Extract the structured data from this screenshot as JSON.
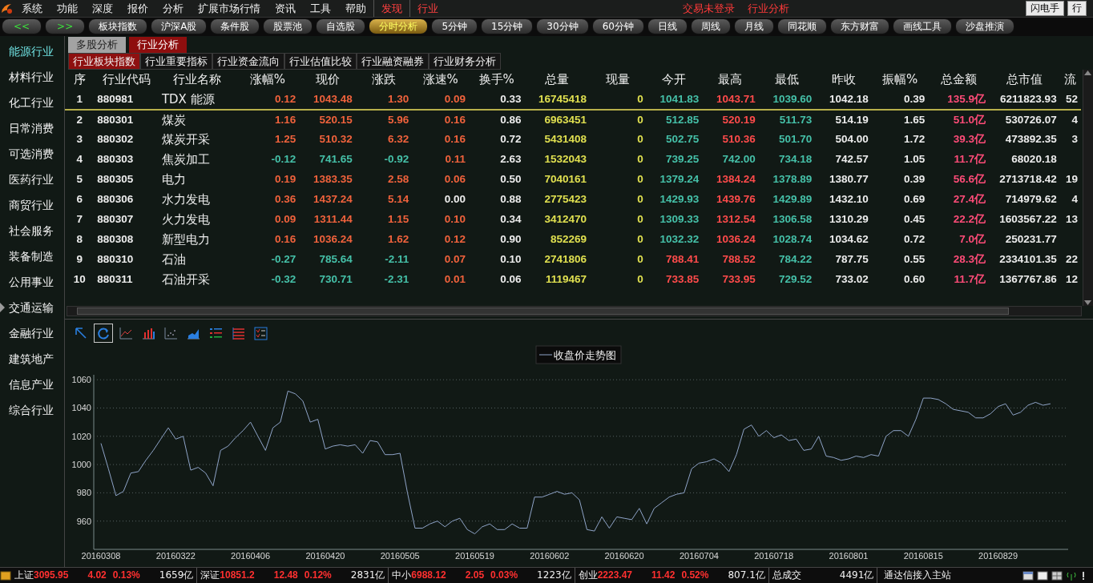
{
  "menu": {
    "items": [
      {
        "label": "系统",
        "kind": "plain"
      },
      {
        "label": "功能",
        "kind": "plain"
      },
      {
        "label": "深度",
        "kind": "plain"
      },
      {
        "label": "报价",
        "kind": "plain"
      },
      {
        "label": "分析",
        "kind": "plain"
      },
      {
        "label": "扩展市场行情",
        "kind": "plain"
      },
      {
        "label": "资讯",
        "kind": "plain"
      },
      {
        "label": "工具",
        "kind": "plain"
      },
      {
        "label": "帮助",
        "kind": "plain"
      },
      {
        "label": "发现",
        "kind": "accent"
      },
      {
        "label": "行业",
        "kind": "accent"
      }
    ],
    "status": [
      "交易未登录",
      "行业分析"
    ],
    "buttons": [
      "闪电手",
      "行"
    ]
  },
  "toolbar": {
    "arrows": [
      "<<",
      ">>"
    ],
    "tabs": [
      {
        "label": "板块指数",
        "selected": false
      },
      {
        "label": "沪深A股",
        "selected": false
      },
      {
        "label": "条件股",
        "selected": false
      },
      {
        "label": "股票池",
        "selected": false
      },
      {
        "label": "自选股",
        "selected": false
      },
      {
        "label": "分时分析",
        "selected": true
      },
      {
        "label": "5分钟",
        "selected": false
      },
      {
        "label": "15分钟",
        "selected": false
      },
      {
        "label": "30分钟",
        "selected": false
      },
      {
        "label": "60分钟",
        "selected": false
      },
      {
        "label": "日线",
        "selected": false
      },
      {
        "label": "周线",
        "selected": false
      },
      {
        "label": "月线",
        "selected": false
      },
      {
        "label": "同花顺",
        "selected": false
      },
      {
        "label": "东方财富",
        "selected": false
      },
      {
        "label": "画线工具",
        "selected": false
      },
      {
        "label": "沙盘推演",
        "selected": false
      }
    ]
  },
  "sidebar": {
    "items": [
      {
        "label": "能源行业",
        "selected": true,
        "pointer": false
      },
      {
        "label": "材料行业",
        "selected": false,
        "pointer": false
      },
      {
        "label": "化工行业",
        "selected": false,
        "pointer": false
      },
      {
        "label": "日常消费",
        "selected": false,
        "pointer": false
      },
      {
        "label": "可选消费",
        "selected": false,
        "pointer": false
      },
      {
        "label": "医药行业",
        "selected": false,
        "pointer": false
      },
      {
        "label": "商贸行业",
        "selected": false,
        "pointer": false
      },
      {
        "label": "社会服务",
        "selected": false,
        "pointer": false
      },
      {
        "label": "装备制造",
        "selected": false,
        "pointer": false
      },
      {
        "label": "公用事业",
        "selected": false,
        "pointer": false
      },
      {
        "label": "交通运输",
        "selected": false,
        "pointer": true
      },
      {
        "label": "金融行业",
        "selected": false,
        "pointer": false
      },
      {
        "label": "建筑地产",
        "selected": false,
        "pointer": false
      },
      {
        "label": "信息产业",
        "selected": false,
        "pointer": false
      },
      {
        "label": "综合行业",
        "selected": false,
        "pointer": false
      }
    ]
  },
  "tabs": [
    {
      "label": "多股分析",
      "selected": false
    },
    {
      "label": "行业分析",
      "selected": true
    }
  ],
  "subtabs": [
    {
      "label": "行业板块指数",
      "selected": true
    },
    {
      "label": "行业重要指标",
      "selected": false
    },
    {
      "label": "行业资金流向",
      "selected": false
    },
    {
      "label": "行业估值比较",
      "selected": false
    },
    {
      "label": "行业融资融券",
      "selected": false
    },
    {
      "label": "行业财务分析",
      "selected": false
    }
  ],
  "table": {
    "columns": [
      "序",
      "行业代码",
      "行业名称",
      "涨幅%",
      "现价",
      "涨跌",
      "涨速%",
      "换手%",
      "总量",
      "现量",
      "今开",
      "最高",
      "最低",
      "昨收",
      "振幅%",
      "总金额",
      "总市值",
      "流"
    ],
    "rows": [
      {
        "selected": true,
        "cells": [
          {
            "text": "1",
            "color": "#ececec"
          },
          {
            "text": "880981",
            "color": "#ececec"
          },
          {
            "text": "TDX 能源",
            "color": "#ececec"
          },
          {
            "text": "0.12",
            "color": "#f0623c"
          },
          {
            "text": "1043.48",
            "color": "#f0623c"
          },
          {
            "text": "1.30",
            "color": "#f0623c"
          },
          {
            "text": "0.09",
            "color": "#f0623c"
          },
          {
            "text": "0.33",
            "color": "#ececec"
          },
          {
            "text": "16745418",
            "color": "#e0e050"
          },
          {
            "text": "0",
            "color": "#e0e050"
          },
          {
            "text": "1041.83",
            "color": "#45c0a8"
          },
          {
            "text": "1043.71",
            "color": "#ff4b4b"
          },
          {
            "text": "1039.60",
            "color": "#45c0a8"
          },
          {
            "text": "1042.18",
            "color": "#ececec"
          },
          {
            "text": "0.39",
            "color": "#ececec"
          },
          {
            "text": "135.9亿",
            "color": "#ff4c78"
          },
          {
            "text": "6211823.93",
            "color": "#ececec"
          },
          {
            "text": "52",
            "color": "#ececec"
          }
        ]
      },
      {
        "selected": false,
        "cells": [
          {
            "text": "2",
            "color": "#ececec"
          },
          {
            "text": "880301",
            "color": "#ececec"
          },
          {
            "text": "煤炭",
            "color": "#ececec"
          },
          {
            "text": "1.16",
            "color": "#f0623c"
          },
          {
            "text": "520.15",
            "color": "#f0623c"
          },
          {
            "text": "5.96",
            "color": "#f0623c"
          },
          {
            "text": "0.16",
            "color": "#f0623c"
          },
          {
            "text": "0.86",
            "color": "#ececec"
          },
          {
            "text": "6963451",
            "color": "#e0e050"
          },
          {
            "text": "0",
            "color": "#e0e050"
          },
          {
            "text": "512.85",
            "color": "#45c0a8"
          },
          {
            "text": "520.19",
            "color": "#ff4b4b"
          },
          {
            "text": "511.73",
            "color": "#45c0a8"
          },
          {
            "text": "514.19",
            "color": "#ececec"
          },
          {
            "text": "1.65",
            "color": "#ececec"
          },
          {
            "text": "51.0亿",
            "color": "#ff4c78"
          },
          {
            "text": "530726.07",
            "color": "#ececec"
          },
          {
            "text": "4",
            "color": "#ececec"
          }
        ]
      },
      {
        "selected": false,
        "cells": [
          {
            "text": "3",
            "color": "#ececec"
          },
          {
            "text": "880302",
            "color": "#ececec"
          },
          {
            "text": "煤炭开采",
            "color": "#ececec"
          },
          {
            "text": "1.25",
            "color": "#f0623c"
          },
          {
            "text": "510.32",
            "color": "#f0623c"
          },
          {
            "text": "6.32",
            "color": "#f0623c"
          },
          {
            "text": "0.16",
            "color": "#f0623c"
          },
          {
            "text": "0.72",
            "color": "#ececec"
          },
          {
            "text": "5431408",
            "color": "#e0e050"
          },
          {
            "text": "0",
            "color": "#e0e050"
          },
          {
            "text": "502.75",
            "color": "#45c0a8"
          },
          {
            "text": "510.36",
            "color": "#ff4b4b"
          },
          {
            "text": "501.70",
            "color": "#45c0a8"
          },
          {
            "text": "504.00",
            "color": "#ececec"
          },
          {
            "text": "1.72",
            "color": "#ececec"
          },
          {
            "text": "39.3亿",
            "color": "#ff4c78"
          },
          {
            "text": "473892.35",
            "color": "#ececec"
          },
          {
            "text": "3",
            "color": "#ececec"
          }
        ]
      },
      {
        "selected": false,
        "cells": [
          {
            "text": "4",
            "color": "#ececec"
          },
          {
            "text": "880303",
            "color": "#ececec"
          },
          {
            "text": "焦炭加工",
            "color": "#ececec"
          },
          {
            "text": "-0.12",
            "color": "#45c0a8"
          },
          {
            "text": "741.65",
            "color": "#45c0a8"
          },
          {
            "text": "-0.92",
            "color": "#45c0a8"
          },
          {
            "text": "0.11",
            "color": "#f0623c"
          },
          {
            "text": "2.63",
            "color": "#ececec"
          },
          {
            "text": "1532043",
            "color": "#e0e050"
          },
          {
            "text": "0",
            "color": "#e0e050"
          },
          {
            "text": "739.25",
            "color": "#45c0a8"
          },
          {
            "text": "742.00",
            "color": "#45c0a8"
          },
          {
            "text": "734.18",
            "color": "#45c0a8"
          },
          {
            "text": "742.57",
            "color": "#ececec"
          },
          {
            "text": "1.05",
            "color": "#ececec"
          },
          {
            "text": "11.7亿",
            "color": "#ff4c78"
          },
          {
            "text": "68020.18",
            "color": "#ececec"
          }
        ]
      },
      {
        "selected": false,
        "cells": [
          {
            "text": "5",
            "color": "#ececec"
          },
          {
            "text": "880305",
            "color": "#ececec"
          },
          {
            "text": "电力",
            "color": "#ececec"
          },
          {
            "text": "0.19",
            "color": "#f0623c"
          },
          {
            "text": "1383.35",
            "color": "#f0623c"
          },
          {
            "text": "2.58",
            "color": "#f0623c"
          },
          {
            "text": "0.06",
            "color": "#f0623c"
          },
          {
            "text": "0.50",
            "color": "#ececec"
          },
          {
            "text": "7040161",
            "color": "#e0e050"
          },
          {
            "text": "0",
            "color": "#e0e050"
          },
          {
            "text": "1379.24",
            "color": "#45c0a8"
          },
          {
            "text": "1384.24",
            "color": "#ff4b4b"
          },
          {
            "text": "1378.89",
            "color": "#45c0a8"
          },
          {
            "text": "1380.77",
            "color": "#ececec"
          },
          {
            "text": "0.39",
            "color": "#ececec"
          },
          {
            "text": "56.6亿",
            "color": "#ff4c78"
          },
          {
            "text": "2713718.42",
            "color": "#ececec"
          },
          {
            "text": "19",
            "color": "#ececec"
          }
        ]
      },
      {
        "selected": false,
        "cells": [
          {
            "text": "6",
            "color": "#ececec"
          },
          {
            "text": "880306",
            "color": "#ececec"
          },
          {
            "text": "水力发电",
            "color": "#ececec"
          },
          {
            "text": "0.36",
            "color": "#f0623c"
          },
          {
            "text": "1437.24",
            "color": "#f0623c"
          },
          {
            "text": "5.14",
            "color": "#f0623c"
          },
          {
            "text": "0.00",
            "color": "#ececec"
          },
          {
            "text": "0.88",
            "color": "#ececec"
          },
          {
            "text": "2775423",
            "color": "#e0e050"
          },
          {
            "text": "0",
            "color": "#e0e050"
          },
          {
            "text": "1429.93",
            "color": "#45c0a8"
          },
          {
            "text": "1439.76",
            "color": "#ff4b4b"
          },
          {
            "text": "1429.89",
            "color": "#45c0a8"
          },
          {
            "text": "1432.10",
            "color": "#ececec"
          },
          {
            "text": "0.69",
            "color": "#ececec"
          },
          {
            "text": "27.4亿",
            "color": "#ff4c78"
          },
          {
            "text": "714979.62",
            "color": "#ececec"
          },
          {
            "text": "4",
            "color": "#ececec"
          }
        ]
      },
      {
        "selected": false,
        "cells": [
          {
            "text": "7",
            "color": "#ececec"
          },
          {
            "text": "880307",
            "color": "#ececec"
          },
          {
            "text": "火力发电",
            "color": "#ececec"
          },
          {
            "text": "0.09",
            "color": "#f0623c"
          },
          {
            "text": "1311.44",
            "color": "#f0623c"
          },
          {
            "text": "1.15",
            "color": "#f0623c"
          },
          {
            "text": "0.10",
            "color": "#f0623c"
          },
          {
            "text": "0.34",
            "color": "#ececec"
          },
          {
            "text": "3412470",
            "color": "#e0e050"
          },
          {
            "text": "0",
            "color": "#e0e050"
          },
          {
            "text": "1309.33",
            "color": "#45c0a8"
          },
          {
            "text": "1312.54",
            "color": "#ff4b4b"
          },
          {
            "text": "1306.58",
            "color": "#45c0a8"
          },
          {
            "text": "1310.29",
            "color": "#ececec"
          },
          {
            "text": "0.45",
            "color": "#ececec"
          },
          {
            "text": "22.2亿",
            "color": "#ff4c78"
          },
          {
            "text": "1603567.22",
            "color": "#ececec"
          },
          {
            "text": "13",
            "color": "#ececec"
          }
        ]
      },
      {
        "selected": false,
        "cells": [
          {
            "text": "8",
            "color": "#ececec"
          },
          {
            "text": "880308",
            "color": "#ececec"
          },
          {
            "text": "新型电力",
            "color": "#ececec"
          },
          {
            "text": "0.16",
            "color": "#f0623c"
          },
          {
            "text": "1036.24",
            "color": "#f0623c"
          },
          {
            "text": "1.62",
            "color": "#f0623c"
          },
          {
            "text": "0.12",
            "color": "#f0623c"
          },
          {
            "text": "0.90",
            "color": "#ececec"
          },
          {
            "text": "852269",
            "color": "#e0e050"
          },
          {
            "text": "0",
            "color": "#e0e050"
          },
          {
            "text": "1032.32",
            "color": "#45c0a8"
          },
          {
            "text": "1036.24",
            "color": "#ff4b4b"
          },
          {
            "text": "1028.74",
            "color": "#45c0a8"
          },
          {
            "text": "1034.62",
            "color": "#ececec"
          },
          {
            "text": "0.72",
            "color": "#ececec"
          },
          {
            "text": "7.0亿",
            "color": "#ff4c78"
          },
          {
            "text": "250231.77",
            "color": "#ececec"
          }
        ]
      },
      {
        "selected": false,
        "cells": [
          {
            "text": "9",
            "color": "#ececec"
          },
          {
            "text": "880310",
            "color": "#ececec"
          },
          {
            "text": "石油",
            "color": "#ececec"
          },
          {
            "text": "-0.27",
            "color": "#45c0a8"
          },
          {
            "text": "785.64",
            "color": "#45c0a8"
          },
          {
            "text": "-2.11",
            "color": "#45c0a8"
          },
          {
            "text": "0.07",
            "color": "#f0623c"
          },
          {
            "text": "0.10",
            "color": "#ececec"
          },
          {
            "text": "2741806",
            "color": "#e0e050"
          },
          {
            "text": "0",
            "color": "#e0e050"
          },
          {
            "text": "788.41",
            "color": "#ff4b4b"
          },
          {
            "text": "788.52",
            "color": "#ff4b4b"
          },
          {
            "text": "784.22",
            "color": "#45c0a8"
          },
          {
            "text": "787.75",
            "color": "#ececec"
          },
          {
            "text": "0.55",
            "color": "#ececec"
          },
          {
            "text": "28.3亿",
            "color": "#ff4c78"
          },
          {
            "text": "2334101.35",
            "color": "#ececec"
          },
          {
            "text": "22",
            "color": "#ececec"
          }
        ]
      },
      {
        "selected": false,
        "cells": [
          {
            "text": "10",
            "color": "#ececec"
          },
          {
            "text": "880311",
            "color": "#ececec"
          },
          {
            "text": "石油开采",
            "color": "#ececec"
          },
          {
            "text": "-0.32",
            "color": "#45c0a8"
          },
          {
            "text": "730.71",
            "color": "#45c0a8"
          },
          {
            "text": "-2.31",
            "color": "#45c0a8"
          },
          {
            "text": "0.01",
            "color": "#f0623c"
          },
          {
            "text": "0.06",
            "color": "#ececec"
          },
          {
            "text": "1119467",
            "color": "#e0e050"
          },
          {
            "text": "0",
            "color": "#e0e050"
          },
          {
            "text": "733.85",
            "color": "#ff4b4b"
          },
          {
            "text": "733.95",
            "color": "#ff4b4b"
          },
          {
            "text": "729.52",
            "color": "#45c0a8"
          },
          {
            "text": "733.02",
            "color": "#ececec"
          },
          {
            "text": "0.60",
            "color": "#ececec"
          },
          {
            "text": "11.7亿",
            "color": "#ff4c78"
          },
          {
            "text": "1367767.86",
            "color": "#ececec"
          },
          {
            "text": "12",
            "color": "#ececec"
          }
        ]
      }
    ]
  },
  "chart_tools": [
    {
      "kind": "pointer",
      "selected": false
    },
    {
      "kind": "refresh",
      "selected": true
    },
    {
      "kind": "line",
      "selected": false
    },
    {
      "kind": "bar",
      "selected": false
    },
    {
      "kind": "scatter",
      "selected": false
    },
    {
      "kind": "area",
      "selected": false
    },
    {
      "kind": "list",
      "selected": false
    },
    {
      "kind": "table",
      "selected": false
    },
    {
      "kind": "checklist",
      "selected": false
    }
  ],
  "chart": {
    "chart_data": {
      "type": "line",
      "grid": true,
      "ylim": [
        940,
        1063.5
      ],
      "yticks": [
        960,
        980,
        1000,
        1020,
        1040,
        1060
      ],
      "categories": [
        "20160308",
        null,
        null,
        null,
        null,
        null,
        null,
        null,
        null,
        null,
        "20160322",
        null,
        null,
        null,
        null,
        null,
        null,
        null,
        null,
        null,
        "20160406",
        null,
        null,
        null,
        null,
        null,
        null,
        null,
        null,
        null,
        "20160420",
        null,
        null,
        null,
        null,
        null,
        null,
        null,
        null,
        null,
        "20160505",
        null,
        null,
        null,
        null,
        null,
        null,
        null,
        null,
        null,
        "20160519",
        null,
        null,
        null,
        null,
        null,
        null,
        null,
        null,
        null,
        "20160602",
        null,
        null,
        null,
        null,
        null,
        null,
        null,
        null,
        null,
        "20160620",
        null,
        null,
        null,
        null,
        null,
        null,
        null,
        null,
        null,
        "20160704",
        null,
        null,
        null,
        null,
        null,
        null,
        null,
        null,
        null,
        "20160718",
        null,
        null,
        null,
        null,
        null,
        null,
        null,
        null,
        null,
        "20160801",
        null,
        null,
        null,
        null,
        null,
        null,
        null,
        null,
        null,
        "20160815",
        null,
        null,
        null,
        null,
        null,
        null,
        null,
        null,
        null,
        "20160829",
        null,
        null,
        null,
        null,
        null,
        null,
        null
      ],
      "series": [
        {
          "name": "收盘价走势图",
          "color": "#8fa4c8",
          "values": [
            1015,
            997,
            978,
            981,
            994,
            995,
            1003,
            1010,
            1018,
            1026,
            1018,
            1020,
            996,
            998,
            994,
            985,
            1010,
            1013,
            1019,
            1024,
            1030,
            1020,
            1010,
            1026,
            1030,
            1052,
            1050,
            1045,
            1030,
            1032,
            1011,
            1013,
            1014,
            1013,
            1014,
            1008,
            1017,
            1016,
            1007,
            1007,
            1008,
            980,
            955,
            955,
            958,
            960,
            956,
            960,
            962,
            954,
            951,
            956,
            958,
            954,
            954,
            958,
            955,
            955,
            977,
            977,
            979,
            981,
            979,
            980,
            975,
            954,
            953,
            963,
            955,
            963,
            962,
            961,
            969,
            958,
            969,
            973,
            977,
            979,
            980,
            997,
            1001,
            1002,
            1004,
            1001,
            995,
            1007,
            1025,
            1028,
            1020,
            1024,
            1019,
            1021,
            1017,
            1018,
            1010,
            1011,
            1020,
            1006,
            1005,
            1003,
            1004,
            1006,
            1005,
            1007,
            1006,
            1020,
            1024,
            1024,
            1020,
            1032,
            1047,
            1047,
            1046,
            1043,
            1039,
            1038,
            1037,
            1033,
            1033,
            1036,
            1041,
            1043,
            1035,
            1037,
            1042,
            1044,
            1042,
            1043
          ]
        }
      ]
    }
  },
  "status_bar": {
    "indices": [
      {
        "name": "上证",
        "price": "3095.95",
        "change": "4.02",
        "pct": "0.13%",
        "amount": "1659亿"
      },
      {
        "name": "深证",
        "price": "10851.2",
        "change": "12.48",
        "pct": "0.12%",
        "amount": "2831亿"
      },
      {
        "name": "中小",
        "price": "6988.12",
        "change": "2.05",
        "pct": "0.03%",
        "amount": "1223亿"
      },
      {
        "name": "创业",
        "price": "2223.47",
        "change": "11.42",
        "pct": "0.52%",
        "amount": "807.1亿"
      }
    ],
    "total": {
      "label": "总成交",
      "value": "4491亿"
    },
    "connection": "通达信接入主站"
  }
}
